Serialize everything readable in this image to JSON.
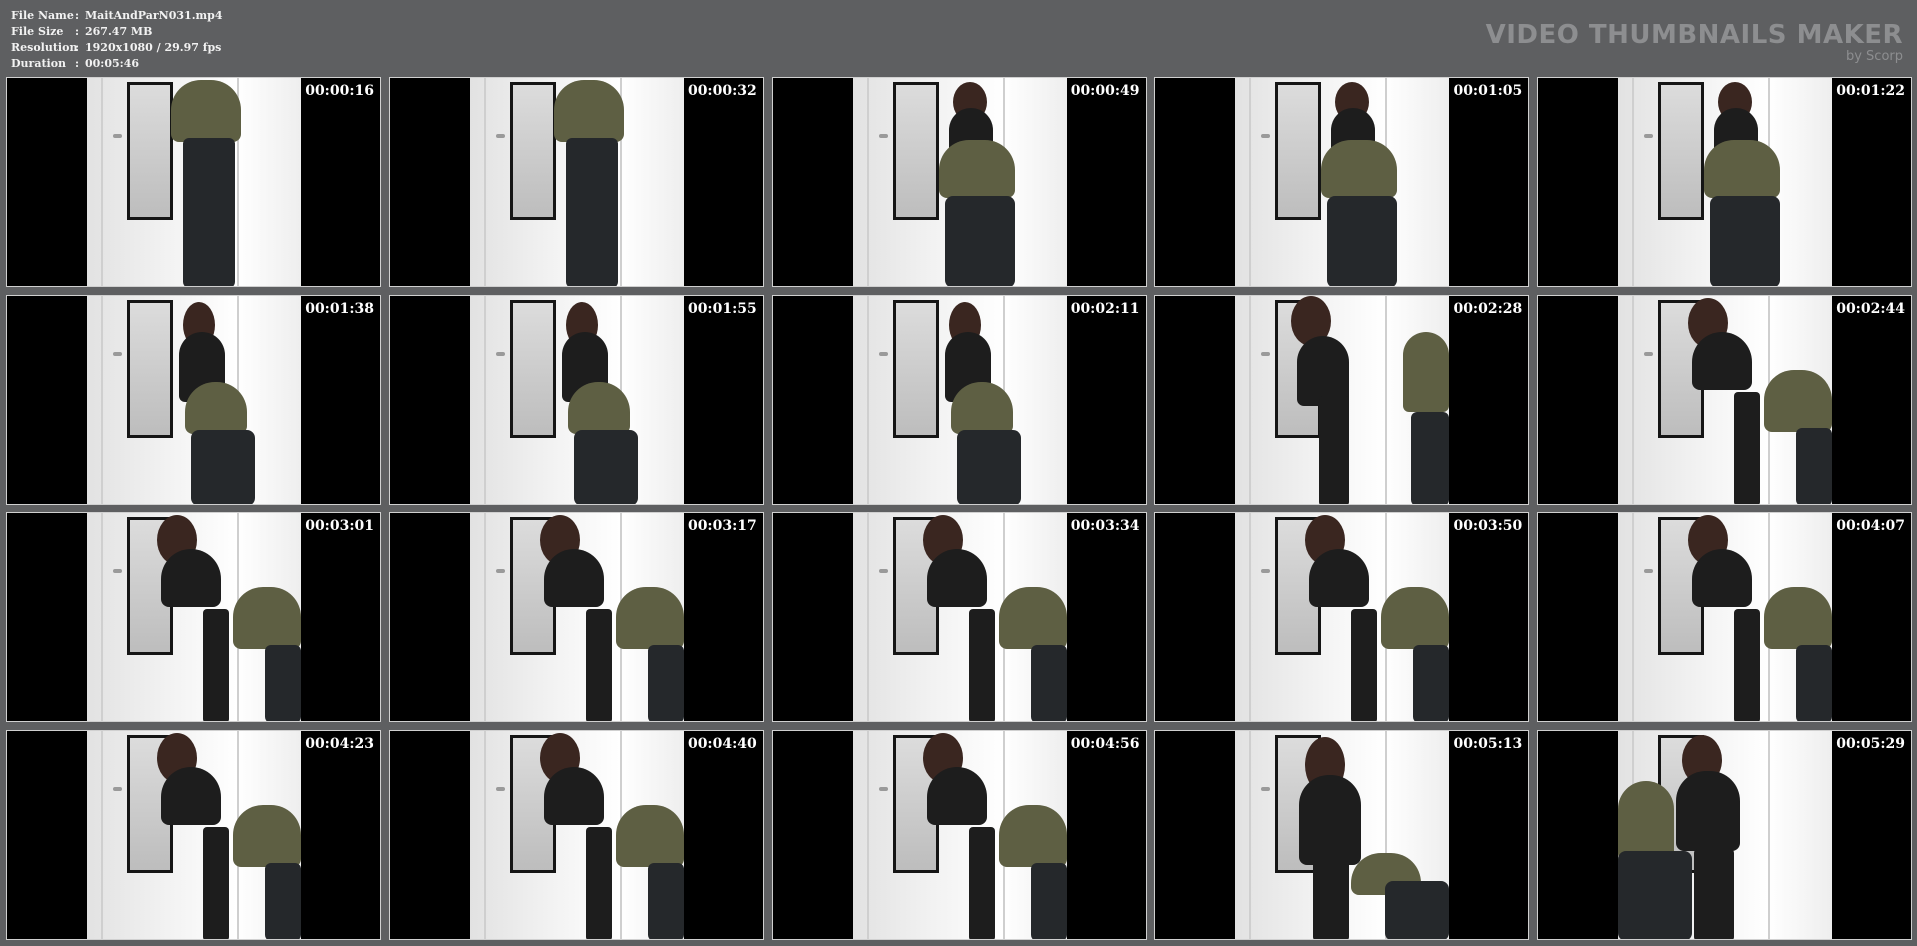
{
  "header": {
    "info": [
      {
        "label": "File Name",
        "value": "MaitAndParN031.mp4"
      },
      {
        "label": "File Size",
        "value": "267.47 MB"
      },
      {
        "label": "Resolution",
        "value": "1920x1080 / 29.97 fps"
      },
      {
        "label": "Duration",
        "value": "00:05:46"
      }
    ],
    "separator": ":",
    "brand_title": "VIDEO THUMBNAILS MAKER",
    "brand_sub": "by Scorp"
  },
  "colors": {
    "background": "#5e5f61",
    "thumb_border": "#d0d0d0",
    "brand": "#8d8e90"
  },
  "thumbnails": [
    {
      "time": "00:00:16",
      "scene": "standing-man"
    },
    {
      "time": "00:00:32",
      "scene": "standing-man"
    },
    {
      "time": "00:00:49",
      "scene": "woman-man-bent"
    },
    {
      "time": "00:01:05",
      "scene": "woman-man-bent"
    },
    {
      "time": "00:01:22",
      "scene": "woman-man-bent"
    },
    {
      "time": "00:01:38",
      "scene": "woman-man-kneel"
    },
    {
      "time": "00:01:55",
      "scene": "woman-man-kneel"
    },
    {
      "time": "00:02:11",
      "scene": "woman-man-kneel"
    },
    {
      "time": "00:02:28",
      "scene": "woman-wall-man-side"
    },
    {
      "time": "00:02:44",
      "scene": "woman-wall-man-close"
    },
    {
      "time": "00:03:01",
      "scene": "woman-wall-man-close"
    },
    {
      "time": "00:03:17",
      "scene": "woman-wall-man-close"
    },
    {
      "time": "00:03:34",
      "scene": "woman-wall-man-close"
    },
    {
      "time": "00:03:50",
      "scene": "woman-wall-man-close"
    },
    {
      "time": "00:04:07",
      "scene": "woman-wall-man-close"
    },
    {
      "time": "00:04:23",
      "scene": "woman-wall-man-close"
    },
    {
      "time": "00:04:40",
      "scene": "woman-wall-man-close"
    },
    {
      "time": "00:04:56",
      "scene": "woman-wall-man-close"
    },
    {
      "time": "00:05:13",
      "scene": "woman-standing-man-floor"
    },
    {
      "time": "00:05:29",
      "scene": "woman-standing-man-foreground"
    }
  ]
}
